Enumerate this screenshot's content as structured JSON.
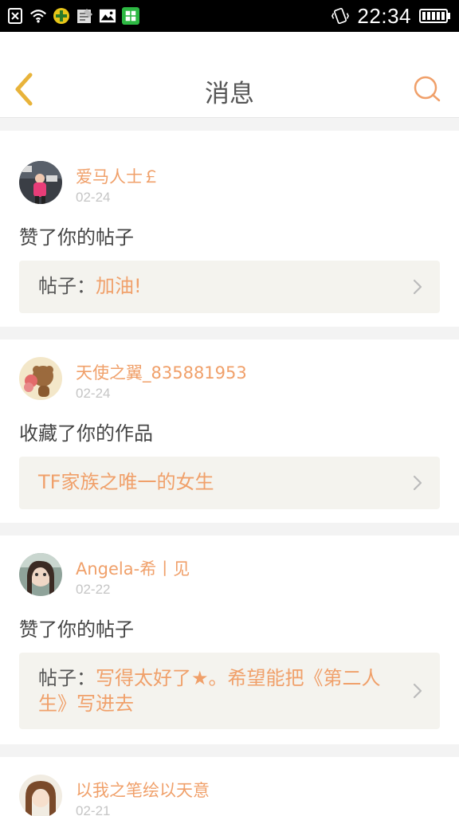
{
  "status_bar": {
    "time": "22:34"
  },
  "header": {
    "title": "消息"
  },
  "messages": [
    {
      "username": "爱马人士￡",
      "date": "02-24",
      "action": "赞了你的帖子",
      "ref_prefix": "帖子：",
      "ref_text": "加油!"
    },
    {
      "username": "天使之翼_835881953",
      "date": "02-24",
      "action": "收藏了你的作品",
      "ref_prefix": "",
      "ref_text": "TF家族之唯一的女生"
    },
    {
      "username": "Angela-希丨见",
      "date": "02-22",
      "action": "赞了你的帖子",
      "ref_prefix": "帖子：",
      "ref_text": "写得太好了★。希望能把《第二人生》写进去"
    },
    {
      "username": "以我之笔绘以天意",
      "date": "02-21",
      "action": "",
      "ref_prefix": "",
      "ref_text": ""
    }
  ],
  "colors": {
    "accent": "#f0a06a",
    "ref_bg": "#f4f3ee",
    "status_bar_bg": "#000000"
  },
  "icons": {
    "back": "chevron-left-icon",
    "search": "search-icon",
    "row_arrow": "chevron-right-icon"
  }
}
